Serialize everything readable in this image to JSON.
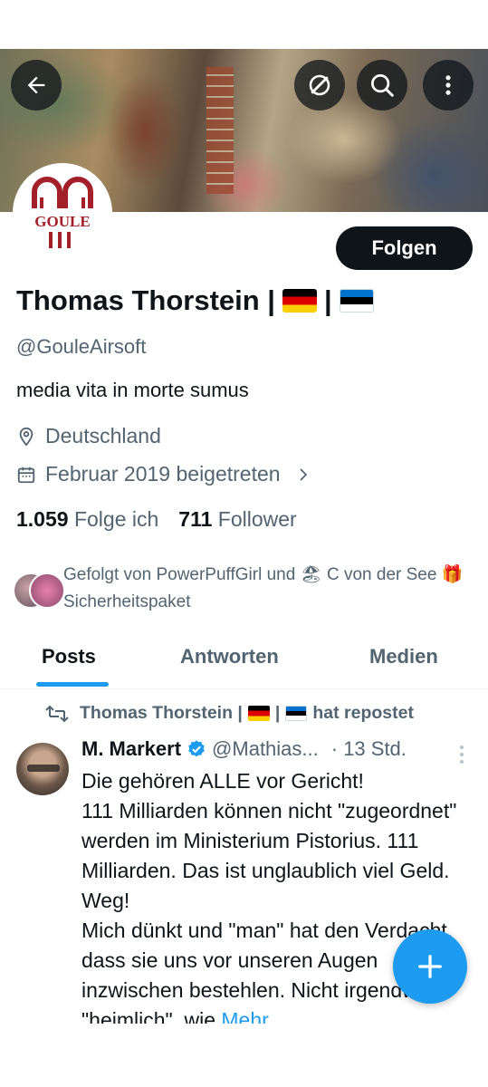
{
  "header": {
    "back_icon": "arrow-left-icon",
    "grok_icon": "grok-icon",
    "search_icon": "search-icon",
    "more_icon": "more-vertical-icon"
  },
  "profile": {
    "avatar_text": "GOULE",
    "follow_label": "Folgen",
    "name": "Thomas Thorstein |",
    "name_sep": "|",
    "handle": "@GouleAirsoft",
    "bio": "media vita in morte sumus",
    "location": "Deutschland",
    "joined": "Februar 2019 beigetreten",
    "following_count": "1.059",
    "following_label": "Folge ich",
    "followers_count": "711",
    "followers_label": "Follower",
    "followed_by_part1": "Gefolgt von PowerPuffGirl und",
    "followed_by_part2": "C von der See",
    "followed_by_part3": "Sicherheitspaket"
  },
  "tabs": [
    {
      "label": "Posts",
      "active": true
    },
    {
      "label": "Antworten",
      "active": false
    },
    {
      "label": "Medien",
      "active": false
    }
  ],
  "tweet": {
    "repost_name": "Thomas Thorstein |",
    "repost_sep": "|",
    "repost_suffix": "hat repostet",
    "author": "M. Markert",
    "handle": "@Mathias...",
    "time": "· 13 Std.",
    "text": "Die gehören ALLE vor Gericht!\n111 Milliarden können nicht \"zugeordnet\" werden im Ministerium Pistorius. 111 Milliarden. Das ist unglaublich viel Geld. Weg!\nMich dünkt und \"man\" hat den Verdacht, dass sie uns vor unseren Augen inzwischen bestehlen. Nicht irgendwie \"heimlich\", wie",
    "more_label": "Mehr"
  },
  "colors": {
    "accent": "#1d9bf0",
    "text": "#0f1419",
    "secondary": "#536471",
    "verified": "#1d9bf0",
    "logo_red": "#a3202a"
  }
}
